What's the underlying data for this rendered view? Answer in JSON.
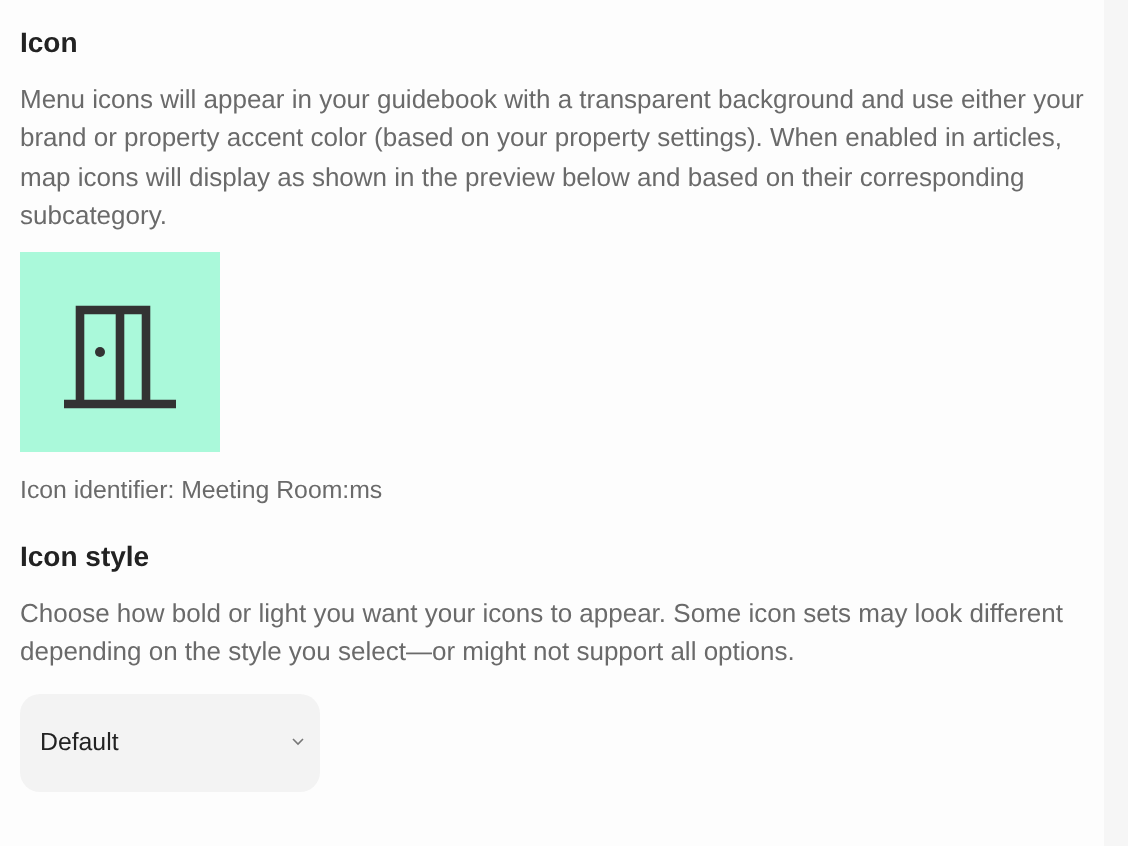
{
  "icon_section": {
    "title": "Icon",
    "description": "Menu icons will appear in your guidebook with a transparent background and use either your brand or property accent color (based on your property settings). When enabled in articles, map icons will display as shown in the preview below and based on their corresponding subcategory.",
    "identifier": "Icon identifier: Meeting Room:ms"
  },
  "icon_style_section": {
    "title": "Icon style",
    "description": "Choose how bold or light you want your icons to appear. Some icon sets may look different depending on the style you select—or might not support all options.",
    "select": {
      "value": "Default"
    }
  }
}
